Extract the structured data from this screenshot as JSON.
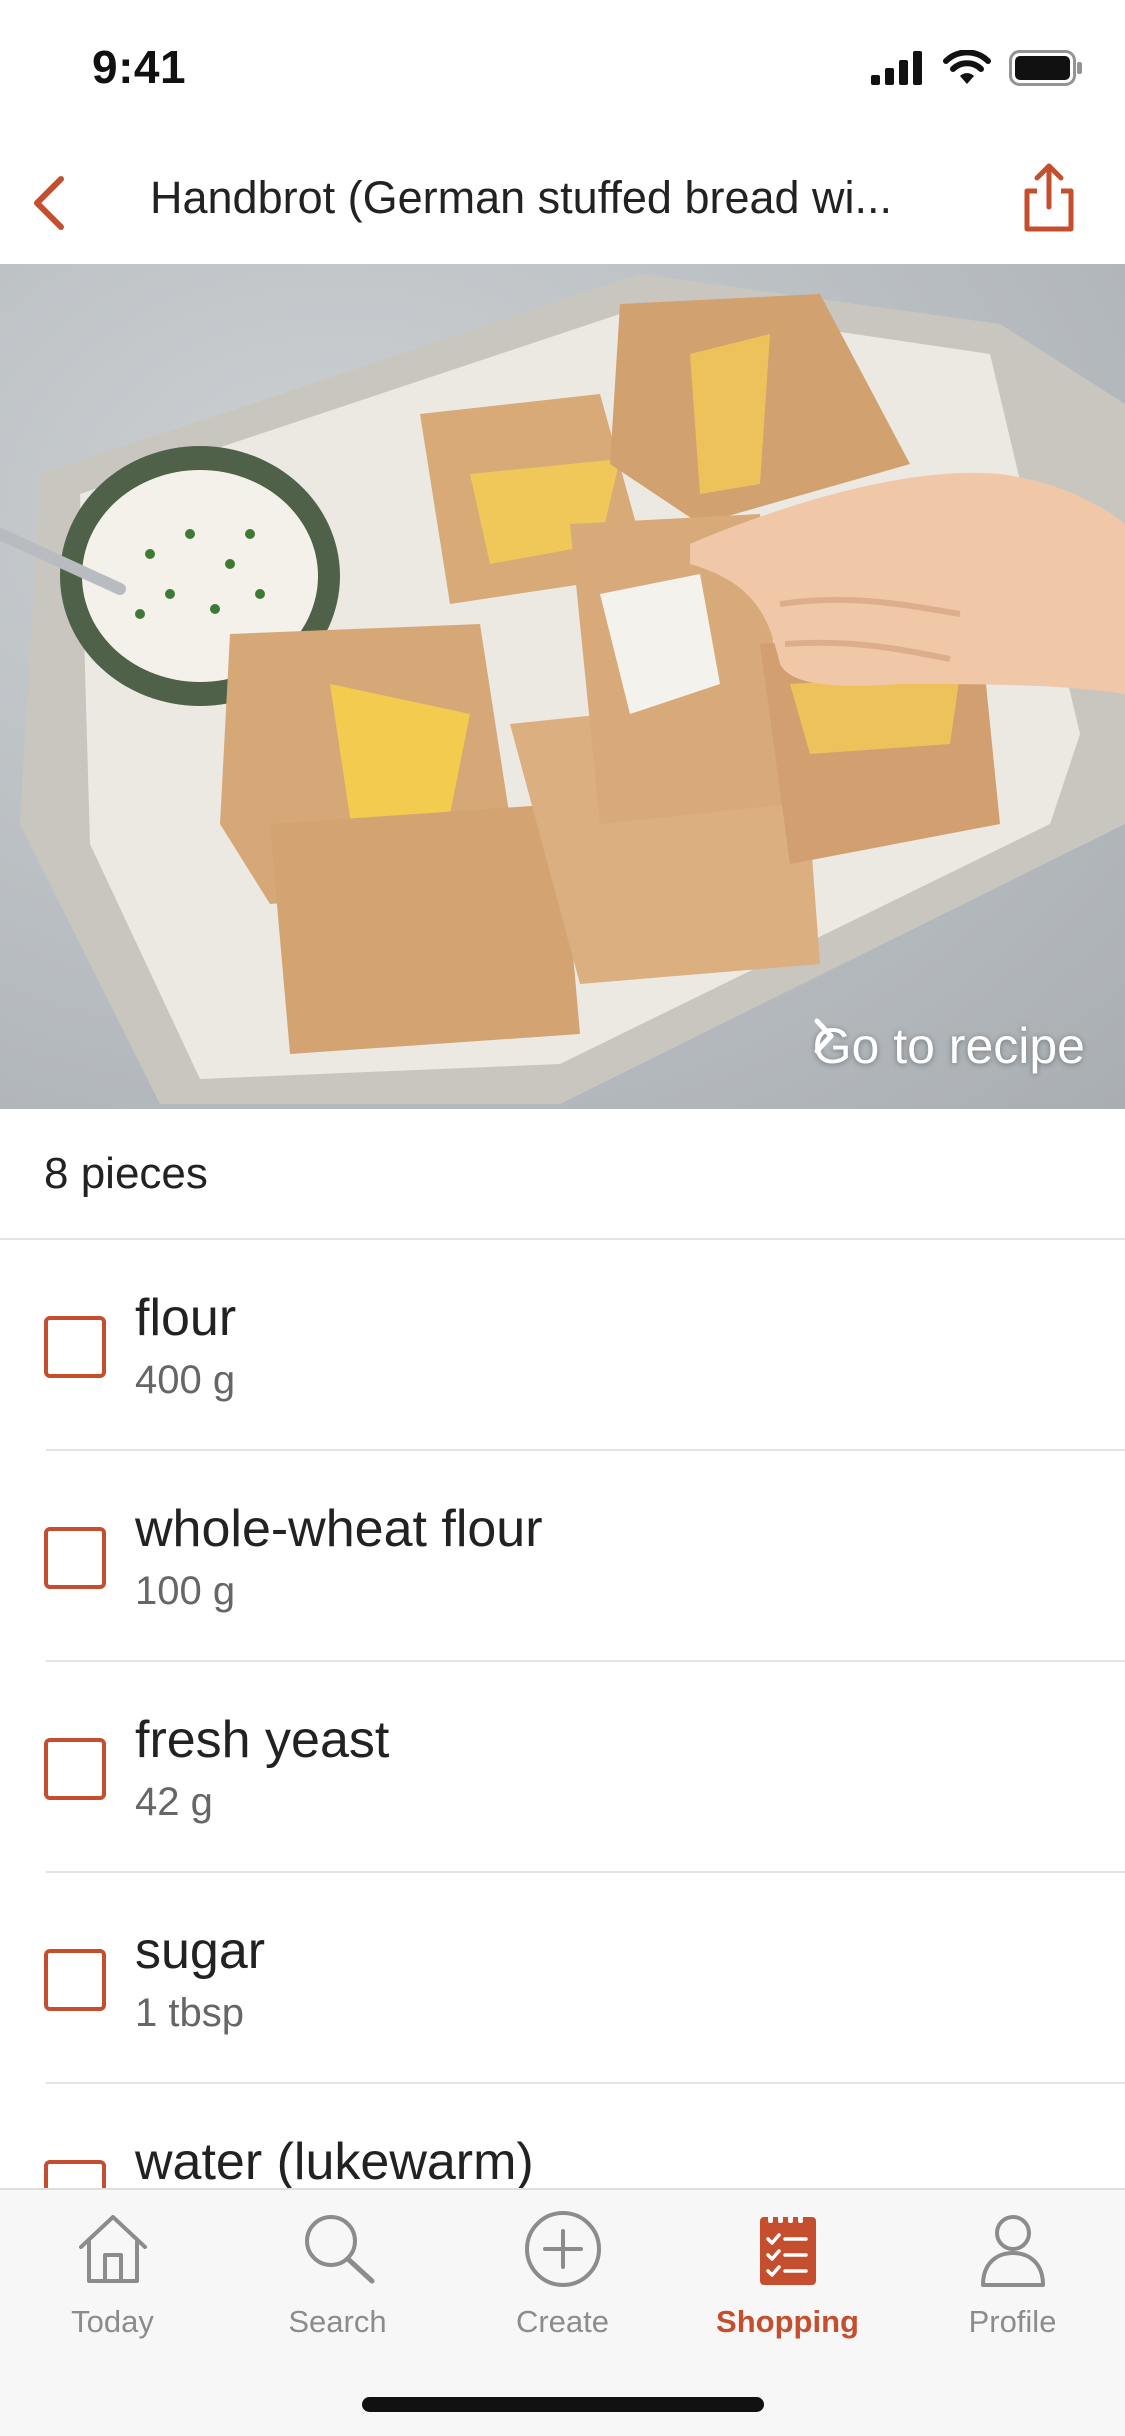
{
  "status_bar": {
    "time": "9:41"
  },
  "nav": {
    "title": "Handbrot (German stuffed bread wi...",
    "back_icon": "chevron-left-icon",
    "share_icon": "share-icon"
  },
  "hero": {
    "link_label": "Go to recipe"
  },
  "yield": {
    "text": "8 pieces"
  },
  "ingredients": [
    {
      "name": "flour",
      "amount": "400 g",
      "checked": false
    },
    {
      "name": "whole-wheat flour",
      "amount": "100 g",
      "checked": false
    },
    {
      "name": "fresh yeast",
      "amount": "42 g",
      "checked": false
    },
    {
      "name": "sugar",
      "amount": "1 tbsp",
      "checked": false
    },
    {
      "name": "water (lukewarm)",
      "amount": "",
      "checked": false
    }
  ],
  "tabs": [
    {
      "label": "Today",
      "icon": "home-icon",
      "active": false
    },
    {
      "label": "Search",
      "icon": "search-icon",
      "active": false
    },
    {
      "label": "Create",
      "icon": "plus-circle-icon",
      "active": false
    },
    {
      "label": "Shopping",
      "icon": "shopping-list-icon",
      "active": true
    },
    {
      "label": "Profile",
      "icon": "profile-icon",
      "active": false
    }
  ],
  "colors": {
    "accent": "#c44e2d",
    "inactive": "#8c8c8c"
  }
}
